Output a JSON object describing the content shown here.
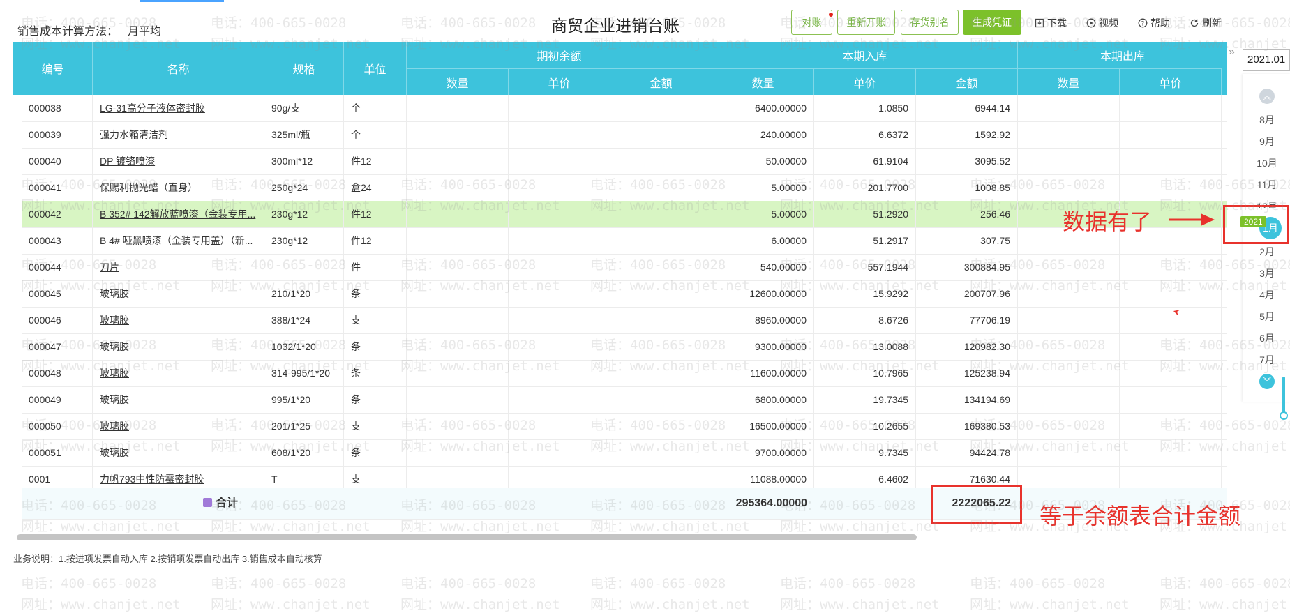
{
  "header": {
    "cost_method_label": "销售成本计算方法：",
    "cost_method_value": "月平均",
    "title": "商贸企业进销台账",
    "buttons": {
      "reconcile": "对账",
      "reopen": "重新开账",
      "alias": "存货别名",
      "gen_voucher": "生成凭证"
    },
    "links": {
      "download": "下载",
      "video": "视频",
      "help": "帮助",
      "refresh": "刷新"
    }
  },
  "table": {
    "columns": {
      "code": "编号",
      "name": "名称",
      "spec": "规格",
      "unit": "单位",
      "group_opening": "期初余额",
      "group_in": "本期入库",
      "group_out": "本期出库",
      "qty": "数量",
      "price": "单价",
      "amount": "金额"
    },
    "rows": [
      {
        "code": "000038",
        "name": "LG-31高分子液体密封胶",
        "spec": "90g/支",
        "unit": "个",
        "in_qty": "6400.00000",
        "in_price": "1.0850",
        "in_amount": "6944.14"
      },
      {
        "code": "000039",
        "name": "强力水箱清洁剂",
        "spec": "325ml/瓶",
        "unit": "个",
        "in_qty": "240.00000",
        "in_price": "6.6372",
        "in_amount": "1592.92"
      },
      {
        "code": "000040",
        "name": "DP 镀铬喷漆",
        "spec": "300ml*12",
        "unit": "件12",
        "in_qty": "50.00000",
        "in_price": "61.9104",
        "in_amount": "3095.52"
      },
      {
        "code": "000041",
        "name": "保赐利抛光蜡（直身）",
        "spec": "250g*24",
        "unit": "盒24",
        "in_qty": "5.00000",
        "in_price": "201.7700",
        "in_amount": "1008.85"
      },
      {
        "code": "000042",
        "name": "B 352# 142解放蓝喷漆（金装专用...",
        "spec": "230g*12",
        "unit": "件12",
        "in_qty": "5.00000",
        "in_price": "51.2920",
        "in_amount": "256.46"
      },
      {
        "code": "000043",
        "name": "B 4# 哑黑喷漆（金装专用盖）（新...",
        "spec": "230g*12",
        "unit": "件12",
        "in_qty": "6.00000",
        "in_price": "51.2917",
        "in_amount": "307.75"
      },
      {
        "code": "000044",
        "name": "刀片",
        "spec": "",
        "unit": "件",
        "in_qty": "540.00000",
        "in_price": "557.1944",
        "in_amount": "300884.95"
      },
      {
        "code": "000045",
        "name": "玻璃胶",
        "spec": "210/1*20",
        "unit": "条",
        "in_qty": "12600.00000",
        "in_price": "15.9292",
        "in_amount": "200707.96"
      },
      {
        "code": "000046",
        "name": "玻璃胶",
        "spec": "388/1*24",
        "unit": "支",
        "in_qty": "8960.00000",
        "in_price": "8.6726",
        "in_amount": "77706.19"
      },
      {
        "code": "000047",
        "name": "玻璃胶",
        "spec": "1032/1*20",
        "unit": "条",
        "in_qty": "9300.00000",
        "in_price": "13.0088",
        "in_amount": "120982.30"
      },
      {
        "code": "000048",
        "name": "玻璃胶",
        "spec": "314-995/1*20",
        "unit": "条",
        "in_qty": "11600.00000",
        "in_price": "10.7965",
        "in_amount": "125238.94"
      },
      {
        "code": "000049",
        "name": "玻璃胶",
        "spec": "995/1*20",
        "unit": "条",
        "in_qty": "6800.00000",
        "in_price": "19.7345",
        "in_amount": "134194.69"
      },
      {
        "code": "000050",
        "name": "玻璃胶",
        "spec": "201/1*25",
        "unit": "支",
        "in_qty": "16500.00000",
        "in_price": "10.2655",
        "in_amount": "169380.53"
      },
      {
        "code": "000051",
        "name": "玻璃胶",
        "spec": "608/1*20",
        "unit": "条",
        "in_qty": "9700.00000",
        "in_price": "9.7345",
        "in_amount": "94424.78"
      },
      {
        "code": "0001",
        "name": "力帆793中性防霉密封胶",
        "spec": "T",
        "unit": "支",
        "in_qty": "11088.00000",
        "in_price": "6.4602",
        "in_amount": "71630.44"
      }
    ],
    "total": {
      "label": "合计",
      "in_qty": "295364.00000",
      "in_amount": "2222065.22"
    }
  },
  "footer": {
    "note": "业务说明：1.按进项发票自动入库  2.按销项发票自动出库  3.销售成本自动核算"
  },
  "date_panel": {
    "current": "2021.01",
    "year_badge": "2021",
    "months": [
      "8月",
      "9月",
      "10月",
      "11月",
      "12月",
      "1月",
      "2月",
      "3月",
      "4月",
      "5月",
      "6月",
      "7月"
    ],
    "active_month": "1月"
  },
  "annotations": {
    "data_ready": "数据有了",
    "equals_total": "等于余额表合计金额",
    "color": "#e8322c"
  },
  "watermark": {
    "phone": "电话：400-665-0028",
    "site": "网址：www.chanjet.net"
  }
}
